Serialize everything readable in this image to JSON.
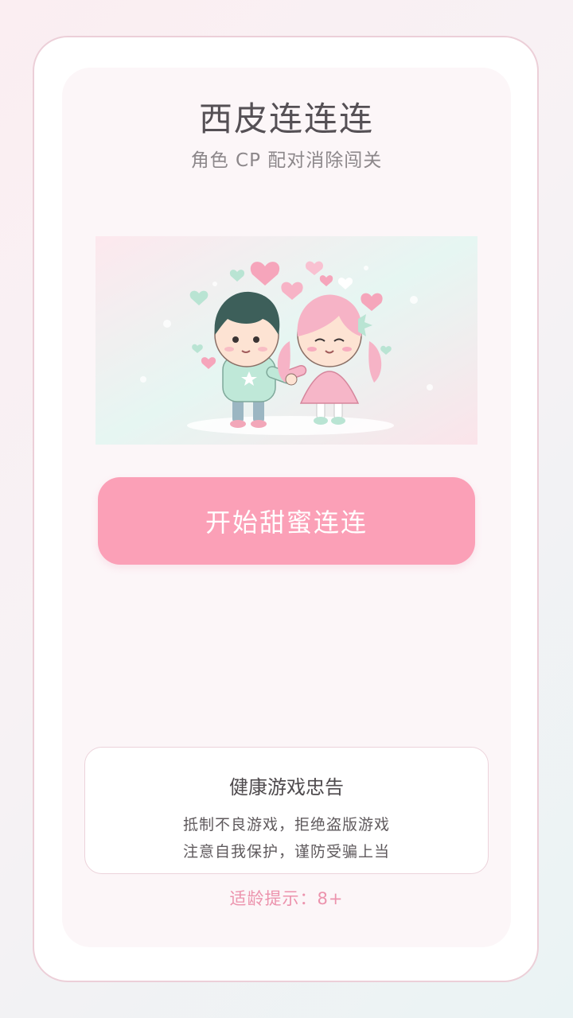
{
  "app": {
    "title": "西皮连连连",
    "subtitle": "角色 CP 配对消除闯关"
  },
  "illustration": {
    "icon": "couple-holding-hands-illustration",
    "colors": {
      "boy_sweater": "#bfe8d8",
      "girl_dress": "#f6b6c8",
      "hair_boy": "#3d5f5a",
      "hair_girl": "#f6b3c6"
    }
  },
  "start_button": {
    "label": "开始甜蜜连连",
    "color": "#fba0b7"
  },
  "notice": {
    "title": "健康游戏忠告",
    "line1": "抵制不良游戏，拒绝盗版游戏",
    "line2": "注意自我保护，谨防受骗上当"
  },
  "age_hint": "适龄提示：8+",
  "colors": {
    "accent": "#fba0b7",
    "age_text": "#ec93ad",
    "card_border": "#eccfd8"
  }
}
